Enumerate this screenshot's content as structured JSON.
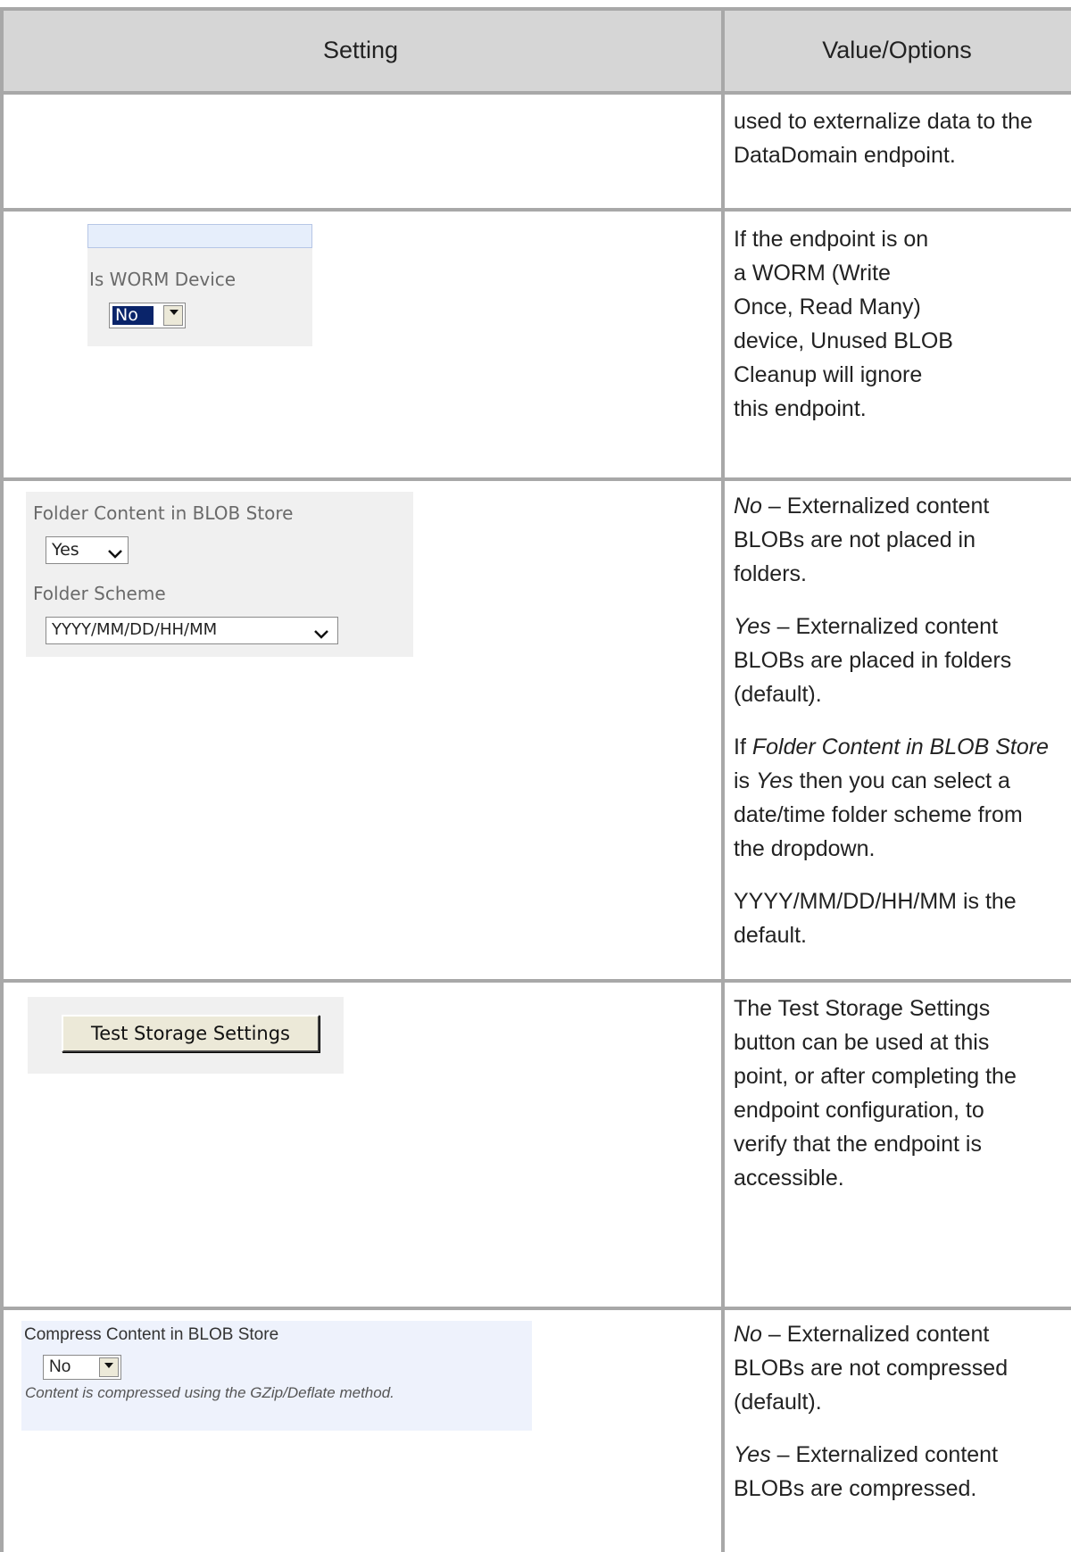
{
  "table": {
    "headers": [
      "Setting",
      "Value/Options"
    ]
  },
  "row1": {
    "desc": [
      "used to externalize data to the",
      "DataDomain endpoint."
    ]
  },
  "row2": {
    "label": "Is WORM Device",
    "select_value": "No",
    "desc": [
      "If the endpoint is on",
      "a WORM (Write",
      "Once, Read Many)",
      "device, Unused BLOB",
      "Cleanup will ignore",
      "this endpoint."
    ]
  },
  "row3": {
    "label_folder_content": "Folder Content in BLOB Store",
    "folder_content_value": "Yes",
    "label_folder_scheme": "Folder Scheme",
    "folder_scheme_value": "YYYY/MM/DD/HH/MM",
    "p1_em": "No",
    "p1_a": " – Externalized content",
    "p1_b": "BLOBs are not placed in",
    "p1_c": "folders.",
    "p2_em": "Yes",
    "p2_a": " – Externalized content",
    "p2_b": "BLOBs are placed in folders",
    "p2_c": "(default).",
    "p3_if": "If ",
    "p3_em1": "Folder Content in BLOB Store",
    "p3_is": "is ",
    "p3_em2": "Yes",
    "p3_a": " then you can select a",
    "p3_b": "date/time folder scheme from",
    "p3_c": "the dropdown.",
    "p4_a": "YYYY/MM/DD/HH/MM is the",
    "p4_b": "default."
  },
  "row4": {
    "button_label": "Test Storage Settings",
    "desc": [
      "The Test Storage Settings",
      "button can be used at this",
      "point, or after completing the",
      "endpoint configuration, to",
      "verify that the endpoint is",
      "accessible."
    ]
  },
  "row5": {
    "label": "Compress Content in BLOB Store",
    "select_value": "No",
    "hint": "Content is compressed using the GZip/Deflate method.",
    "p1_em": "No",
    "p1_a": " – Externalized content",
    "p1_b": "BLOBs are not compressed",
    "p1_c": "(default).",
    "p2_em": "Yes",
    "p2_a": " – Externalized content",
    "p2_b": "BLOBs are compressed."
  },
  "colors": {
    "header_bg": "#d6d6d6",
    "grid_line": "#a8a8a8",
    "panel_gray": "#f0f0f0",
    "panel_blue": "#eef2fc",
    "selected_bg": "#0a246a"
  }
}
